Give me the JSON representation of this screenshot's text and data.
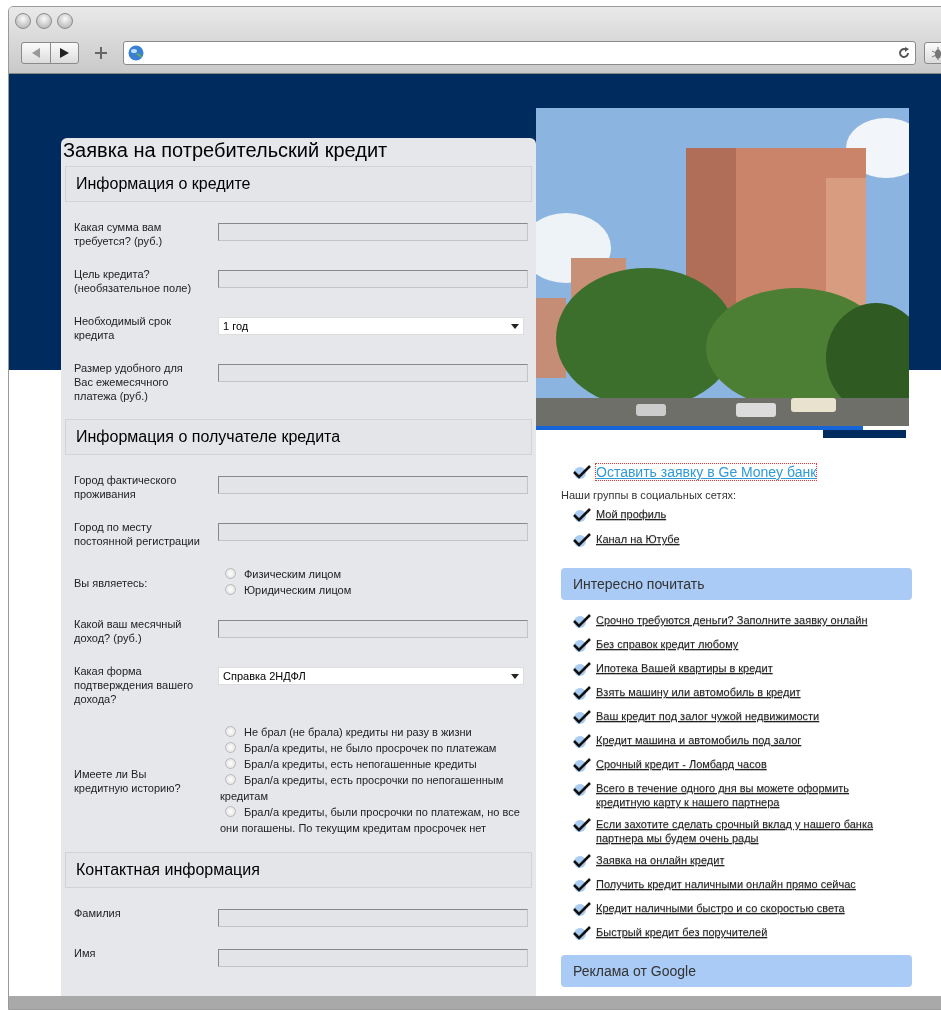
{
  "form": {
    "title": "Заявка на потребительский кредит",
    "sections": [
      {
        "title": "Информация о кредите",
        "fields": [
          {
            "kind": "text",
            "label": "Какая сумма вам требуется? (руб.)"
          },
          {
            "kind": "text",
            "label": "Цель кредита? (необязательное поле)"
          },
          {
            "kind": "select",
            "label": "Необходимый срок кредита",
            "value": "1 год"
          },
          {
            "kind": "text",
            "label": "Размер удобного для Вас ежемесячного платежа (руб.)"
          }
        ]
      },
      {
        "title": "Информация о получателе кредита",
        "fields": [
          {
            "kind": "text",
            "label": "Город фактического проживания"
          },
          {
            "kind": "text",
            "label": "Город по месту постоянной регистрации"
          },
          {
            "kind": "radio",
            "label": "Вы являетесь:",
            "options": [
              {
                "label": "Физическим лицом",
                "selected": false
              },
              {
                "label": "Юридическим лицом",
                "selected": false
              }
            ]
          },
          {
            "kind": "text",
            "label": "Какой ваш месячный доход? (руб.)"
          },
          {
            "kind": "select",
            "label": "Какая форма подтверждения вашего дохода?",
            "value": "Справка 2НДФЛ"
          },
          {
            "kind": "radio",
            "label": "Имеете ли Вы кредитную историю?",
            "options": [
              {
                "label": "Не брал (не брала) кредиты ни разу в жизни",
                "selected": false
              },
              {
                "label": "Брал/а кредиты, не было просрочек по платежам",
                "selected": false
              },
              {
                "label": "Брал/а кредиты, есть непогашенные кредиты",
                "selected": false
              },
              {
                "label": "Брал/а кредиты, есть просрочки по непогашенным кредитам",
                "selected": false
              },
              {
                "label": "Брал/а кредиты, были просрочки по платежам, но все они погашены. По текущим кредитам просрочек нет",
                "selected": false
              }
            ]
          }
        ]
      },
      {
        "title": "Контактная информация",
        "fields": [
          {
            "kind": "text",
            "label": "Фамилия"
          },
          {
            "kind": "text",
            "label": "Имя"
          }
        ]
      }
    ]
  },
  "sidebar": {
    "primary_link": {
      "text": "Оставить заявку в Ge Money банк",
      "focused": true
    },
    "social_label": "Наши группы в социальных сетях:",
    "social_links": [
      "Мой профиль",
      "Канал на Ютубе"
    ],
    "reading": {
      "title": "Интересно почитать",
      "links": [
        "Срочно требуются деньги? Заполните заявку онлайн",
        "Без справок кредит любому",
        "Ипотека Вашей квартиры в кредит",
        "Взять машину или автомобиль в кредит",
        "Ваш кредит под залог чужой недвижимости",
        "Кредит машина и автомобиль под залог",
        "Срочный кредит - Ломбард часов",
        "Всего в течение одного дня вы можете оформить кредитную карту к нашего партнера",
        "Если захотите сделать срочный вклад у нашего банка партнера мы будем очень рады",
        "Заявка на онлайн кредит",
        "Получить кредит наличными онлайн прямо сейчас",
        "Кредит наличными быстро и со скоростью света",
        "Быстрый кредит без поручителей"
      ]
    },
    "ads": {
      "title": "Реклама от Google"
    }
  }
}
